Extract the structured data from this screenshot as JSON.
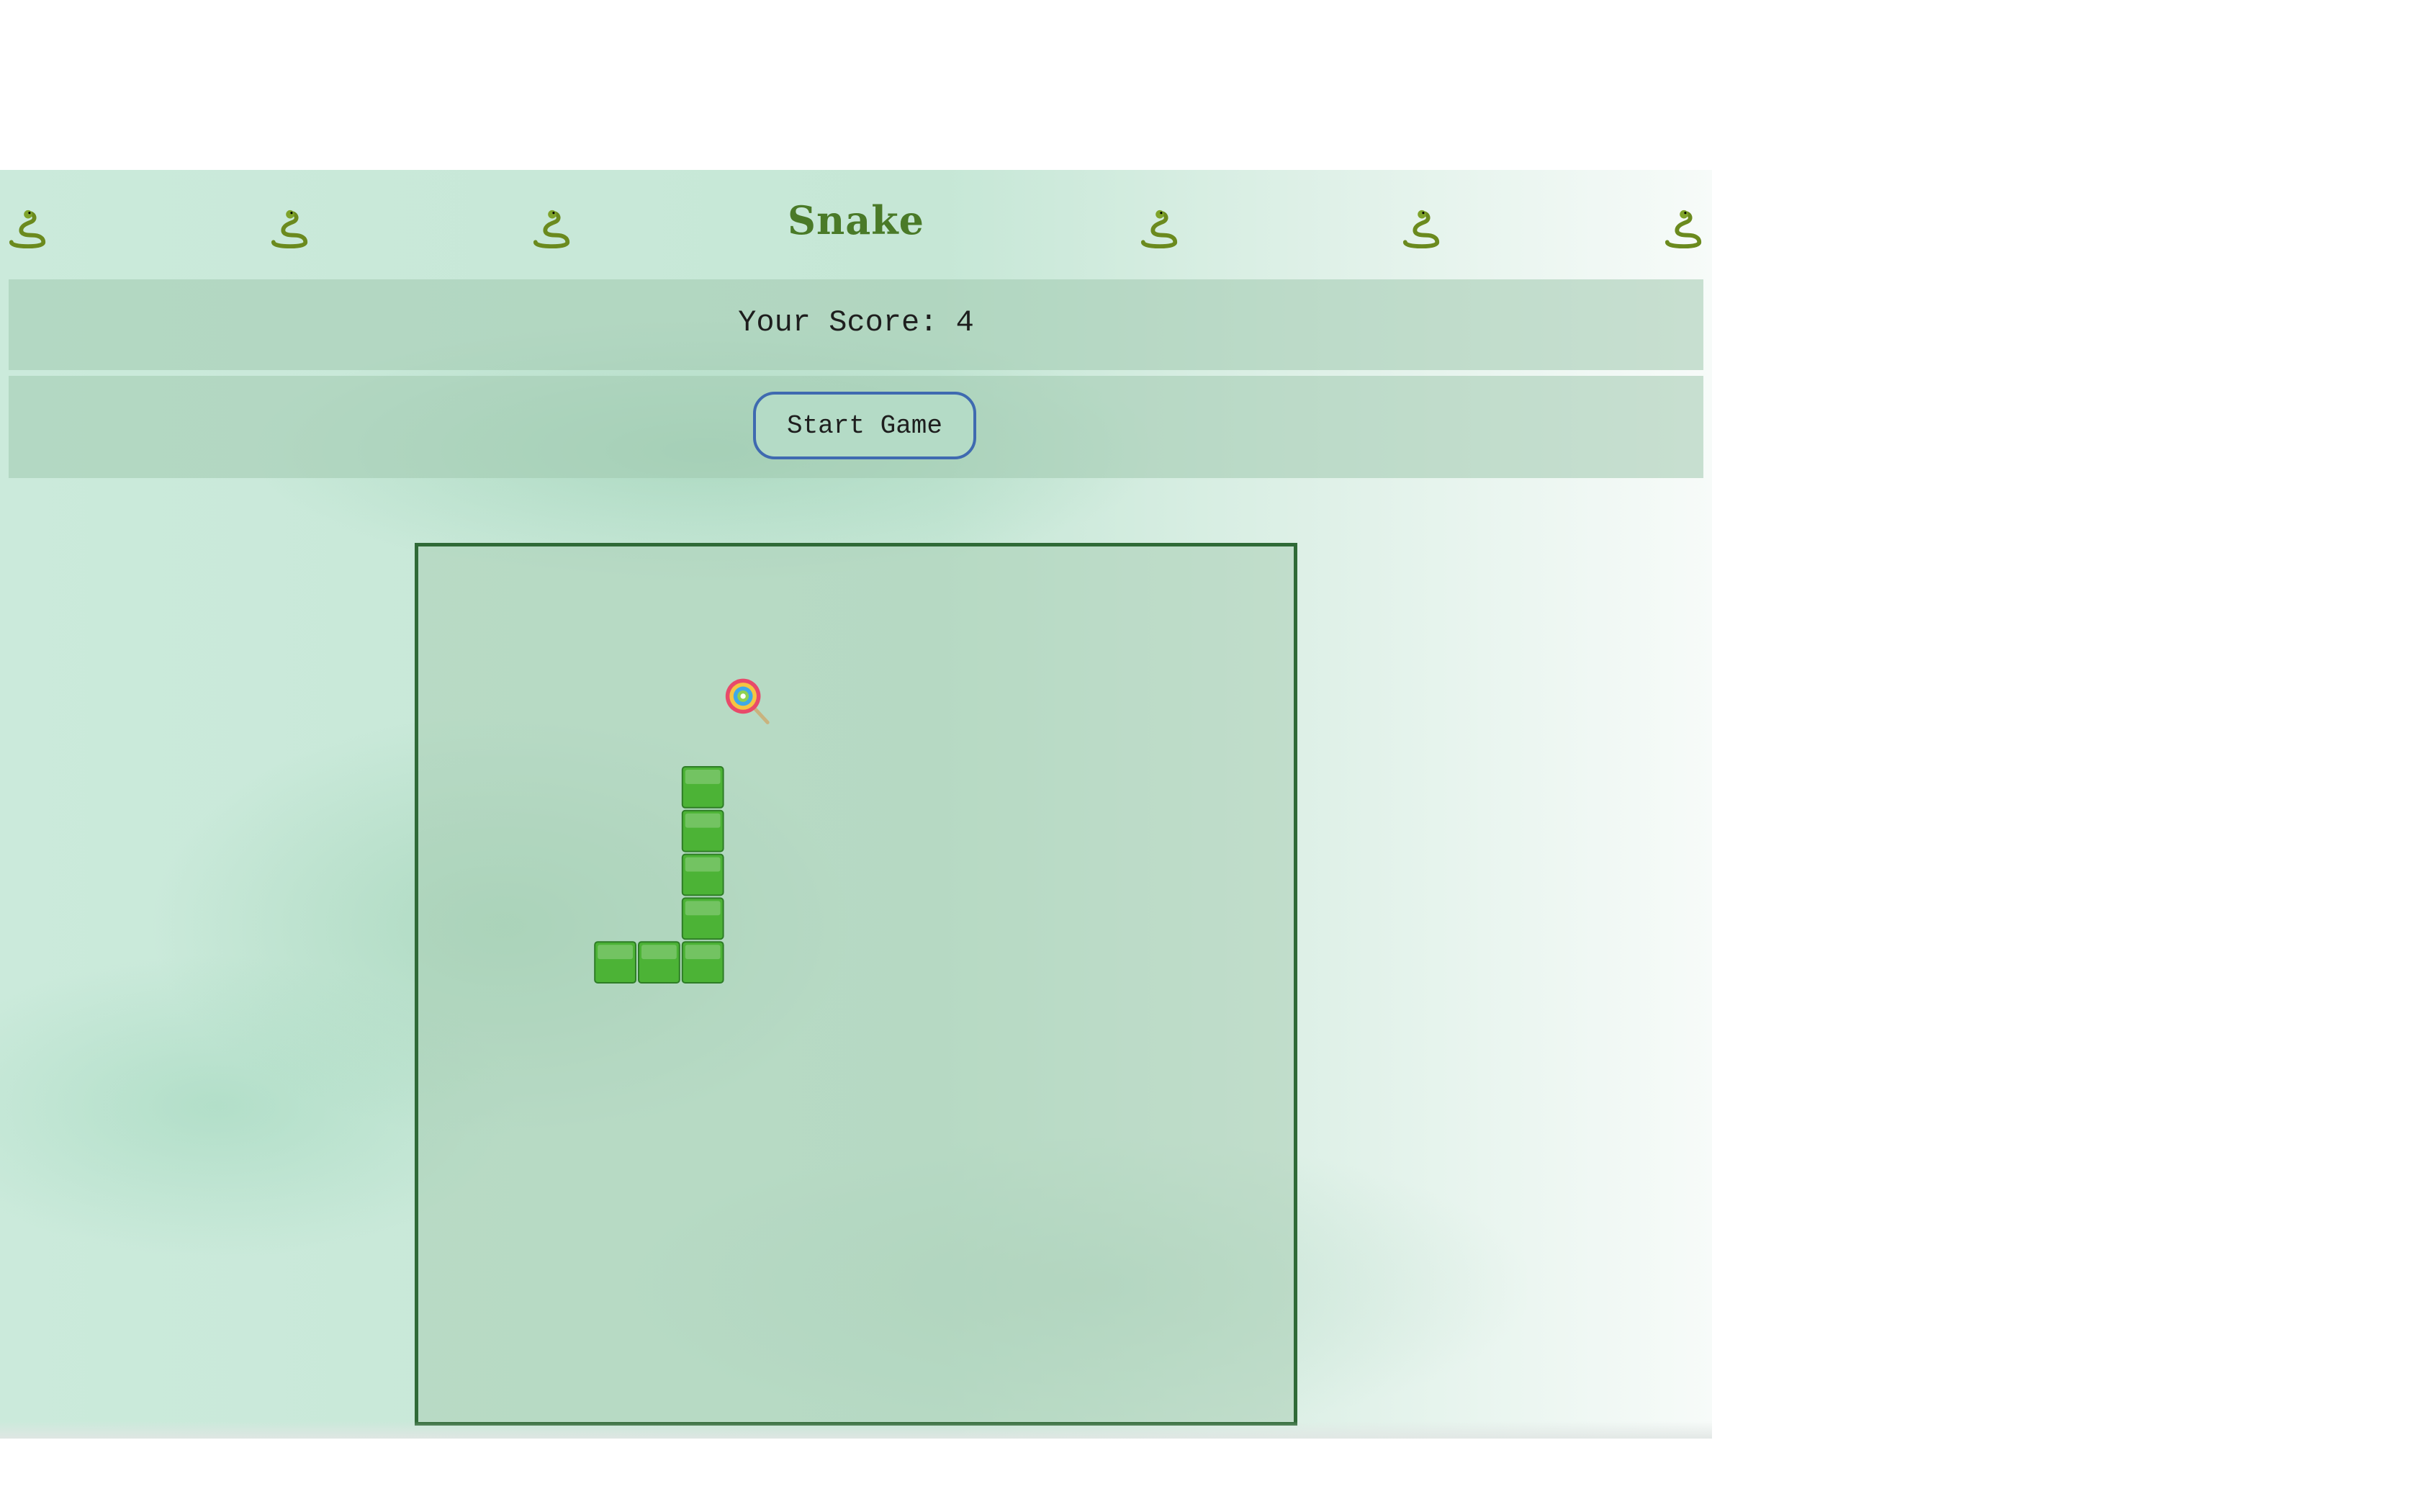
{
  "header": {
    "title": "Snake",
    "decoration_icon": "snake-icon"
  },
  "score": {
    "label": "Your Score: 4"
  },
  "controls": {
    "start_label": "Start Game"
  },
  "board": {
    "grid_size": 20,
    "food": {
      "icon": "lollipop-icon",
      "cell": [
        7,
        3
      ]
    },
    "snake": [
      [
        6,
        9
      ],
      [
        5,
        9
      ],
      [
        4,
        9
      ],
      [
        6,
        8
      ],
      [
        6,
        7
      ],
      [
        6,
        6
      ],
      [
        6,
        5
      ]
    ]
  },
  "colors": {
    "snake_fill": "#4cb336",
    "snake_border": "#2e7d26",
    "board_border": "#2f6a37",
    "title": "#4a7a28",
    "button_border": "#3f6ab0"
  }
}
